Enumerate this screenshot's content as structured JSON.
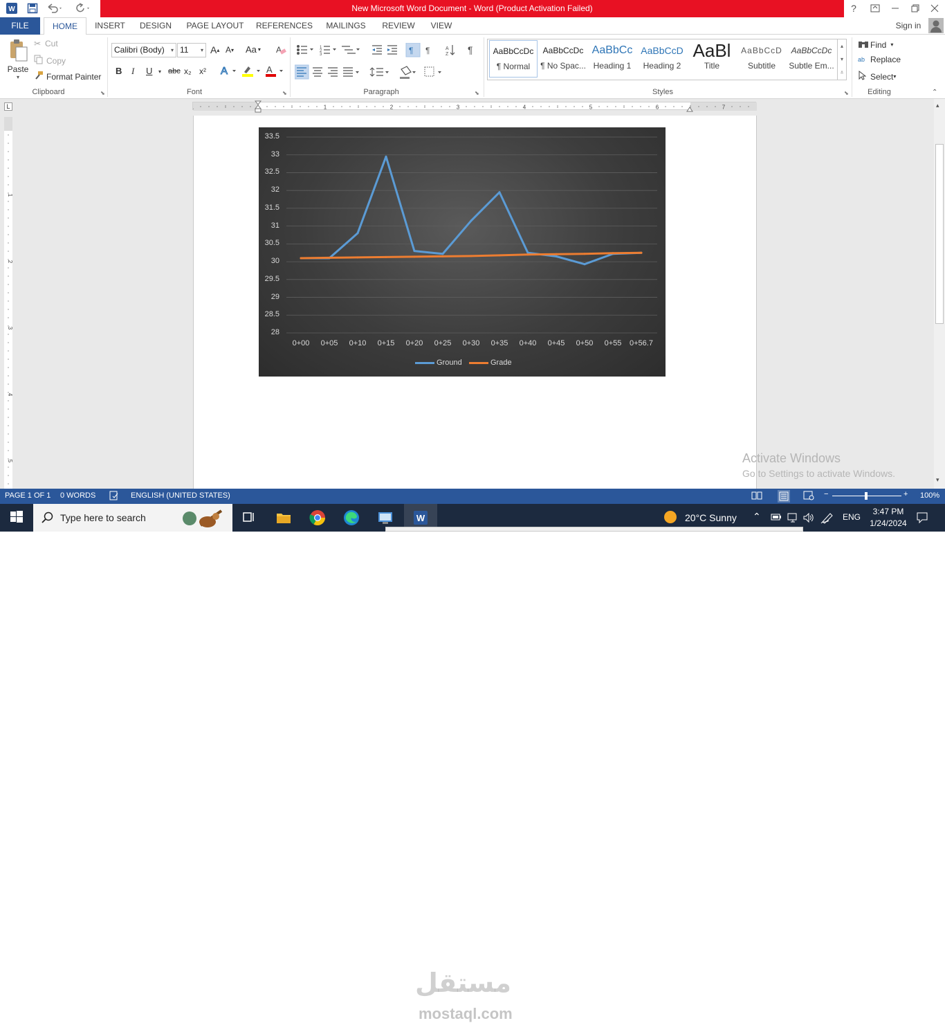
{
  "window": {
    "title": "New Microsoft Word Document -  Word (Product Activation Failed)",
    "help": "?",
    "sign_in": "Sign in"
  },
  "tabs": [
    "FILE",
    "HOME",
    "INSERT",
    "DESIGN",
    "PAGE LAYOUT",
    "REFERENCES",
    "MAILINGS",
    "REVIEW",
    "VIEW"
  ],
  "ribbon": {
    "clipboard": {
      "paste": "Paste",
      "cut": "Cut",
      "copy": "Copy",
      "format_painter": "Format Painter",
      "label": "Clipboard"
    },
    "font": {
      "name": "Calibri (Body)",
      "size": "11",
      "label": "Font",
      "bold": "B",
      "italic": "I",
      "underline": "U",
      "strike": "abc",
      "sub": "x₂",
      "sup": "x²",
      "grow": "A",
      "shrink": "A",
      "case": "Aa"
    },
    "paragraph": {
      "label": "Paragraph",
      "pilcrow": "¶"
    },
    "styles": {
      "label": "Styles",
      "items": [
        {
          "sample": "AaBbCcDc",
          "name": "¶ Normal"
        },
        {
          "sample": "AaBbCcDc",
          "name": "¶ No Spac..."
        },
        {
          "sample": "AaBbCc",
          "name": "Heading 1"
        },
        {
          "sample": "AaBbCcD",
          "name": "Heading 2"
        },
        {
          "sample": "AaBl",
          "name": "Title"
        },
        {
          "sample": "AaBbCcD",
          "name": "Subtitle"
        },
        {
          "sample": "AaBbCcDc",
          "name": "Subtle Em..."
        }
      ]
    },
    "editing": {
      "label": "Editing",
      "find": "Find",
      "replace": "Replace",
      "select": "Select"
    }
  },
  "ruler": {
    "numbers": [
      "1",
      "1",
      "2",
      "3",
      "4",
      "5",
      "6",
      "7"
    ]
  },
  "chart_data": {
    "type": "line",
    "categories": [
      "0+00",
      "0+05",
      "0+10",
      "0+15",
      "0+20",
      "0+25",
      "0+30",
      "0+35",
      "0+40",
      "0+45",
      "0+50",
      "0+55",
      "0+56.7"
    ],
    "series": [
      {
        "name": "Ground",
        "color": "#5b9bd5",
        "values": [
          30.1,
          30.1,
          30.8,
          32.95,
          30.3,
          30.22,
          31.15,
          31.95,
          30.25,
          30.15,
          29.93,
          30.22,
          30.25
        ]
      },
      {
        "name": "Grade",
        "color": "#ed7d31",
        "values": [
          30.1,
          30.11,
          30.12,
          30.13,
          30.14,
          30.15,
          30.16,
          30.18,
          30.2,
          30.21,
          30.22,
          30.24,
          30.25
        ]
      }
    ],
    "ylim": [
      28,
      33.5
    ],
    "yticks": [
      "33.5",
      "33",
      "32.5",
      "32",
      "31.5",
      "31",
      "30.5",
      "30",
      "29.5",
      "29",
      "28.5",
      "28"
    ],
    "grid": true,
    "legend": "bottom",
    "background": "#3d3d3d"
  },
  "status": {
    "page": "PAGE 1 OF 1",
    "words": "0 WORDS",
    "language": "ENGLISH (UNITED STATES)",
    "zoom": "100%"
  },
  "activation": {
    "line1": "Activate Windows",
    "line2": "Go to Settings to activate Windows."
  },
  "watermark": {
    "arabic": "مستقل",
    "latin": "mostaql.com"
  },
  "taskbar": {
    "search_placeholder": "Type here to search",
    "weather": "20°C  Sunny",
    "lang": "ENG",
    "time": "3:47 PM",
    "date": "1/24/2024"
  }
}
